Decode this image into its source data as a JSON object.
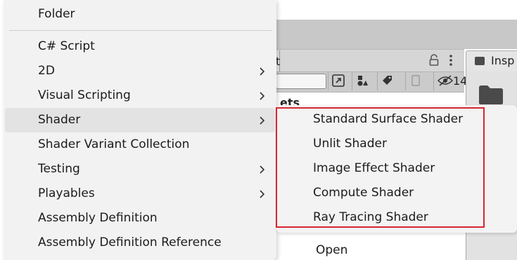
{
  "background": {
    "project_tab_fragment": "t",
    "inspector_tab_label": "Insp",
    "hidden_count": "14",
    "assets_fragment": "ets",
    "partial_text": "o",
    "open_label": "Open"
  },
  "menu": {
    "items": [
      {
        "label": "Folder",
        "has_submenu": false
      },
      {
        "label": "C# Script",
        "has_submenu": false
      },
      {
        "label": "2D",
        "has_submenu": true
      },
      {
        "label": "Visual Scripting",
        "has_submenu": true
      },
      {
        "label": "Shader",
        "has_submenu": true,
        "highlighted": true
      },
      {
        "label": "Shader Variant Collection",
        "has_submenu": false
      },
      {
        "label": "Testing",
        "has_submenu": true
      },
      {
        "label": "Playables",
        "has_submenu": true
      },
      {
        "label": "Assembly Definition",
        "has_submenu": false
      },
      {
        "label": "Assembly Definition Reference",
        "has_submenu": false
      }
    ]
  },
  "submenu": {
    "items": [
      {
        "label": "Standard Surface Shader"
      },
      {
        "label": "Unlit Shader"
      },
      {
        "label": "Image Effect Shader"
      },
      {
        "label": "Compute Shader"
      },
      {
        "label": "Ray Tracing Shader"
      }
    ]
  },
  "colors": {
    "highlight_border": "#d6262f",
    "menu_background": "#f2f2f2",
    "hover_background": "#e3e3e3"
  }
}
